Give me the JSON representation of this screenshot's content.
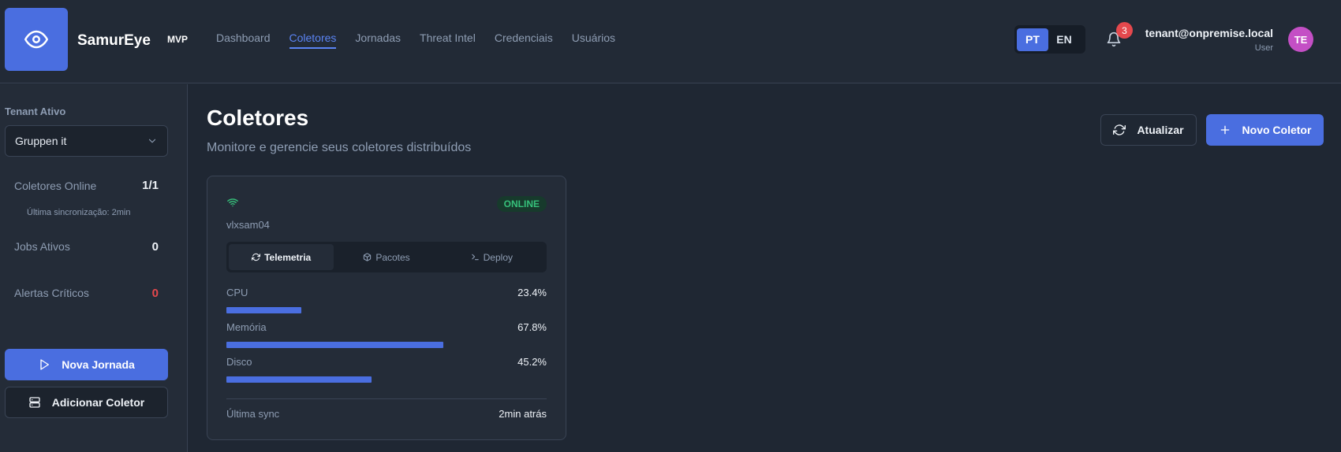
{
  "header": {
    "brand": "SamurEye",
    "badge": "MVP",
    "nav": [
      {
        "label": "Dashboard",
        "active": false
      },
      {
        "label": "Coletores",
        "active": true
      },
      {
        "label": "Jornadas",
        "active": false
      },
      {
        "label": "Threat Intel",
        "active": false
      },
      {
        "label": "Credenciais",
        "active": false
      },
      {
        "label": "Usuários",
        "active": false
      }
    ],
    "languages": [
      {
        "label": "PT",
        "active": true
      },
      {
        "label": "EN",
        "active": false
      }
    ],
    "notification_count": "3",
    "user_email": "tenant@onpremise.local",
    "user_role": "User",
    "avatar_initials": "TE"
  },
  "sidebar": {
    "tenant_label": "Tenant Ativo",
    "tenant_value": "Gruppen it",
    "collectors_online_label": "Coletores Online",
    "collectors_online_value": "1/1",
    "last_sync": "Última sincronização: 2min",
    "jobs_label": "Jobs Ativos",
    "jobs_value": "0",
    "alerts_label": "Alertas Críticos",
    "alerts_value": "0",
    "new_journey_label": "Nova Jornada",
    "add_collector_label": "Adicionar Coletor"
  },
  "main": {
    "title": "Coletores",
    "subtitle": "Monitore e gerencie seus coletores distribuídos",
    "refresh_label": "Atualizar",
    "new_collector_label": "Novo Coletor"
  },
  "collector": {
    "status": "ONLINE",
    "hostname": "vlxsam04",
    "tabs": [
      {
        "label": "Telemetria",
        "icon": "refresh-icon",
        "active": true
      },
      {
        "label": "Pacotes",
        "icon": "package-icon",
        "active": false
      },
      {
        "label": "Deploy",
        "icon": "terminal-icon",
        "active": false
      }
    ],
    "metrics": [
      {
        "label": "CPU",
        "value": "23.4%",
        "fraction": 0.234
      },
      {
        "label": "Memória",
        "value": "67.8%",
        "fraction": 0.678
      },
      {
        "label": "Disco",
        "value": "45.2%",
        "fraction": 0.452
      }
    ],
    "last_sync_label": "Última sync",
    "last_sync_value": "2min atrás"
  },
  "colors": {
    "accent": "#4a6ee0",
    "online": "#36c07a",
    "danger": "#e5484d"
  }
}
